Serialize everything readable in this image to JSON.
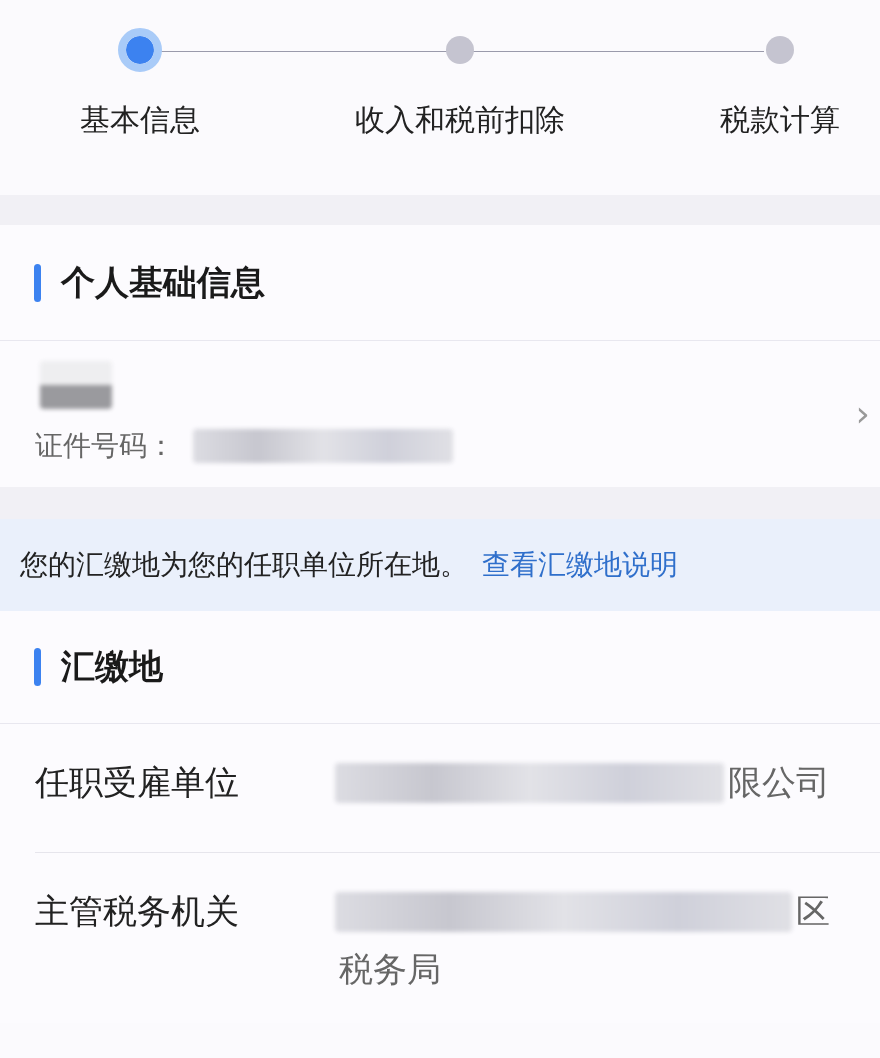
{
  "steps": [
    {
      "label": "基本信息",
      "selected": true
    },
    {
      "label": "收入和税前扣除",
      "selected": false
    },
    {
      "label": "税款计算",
      "selected": false
    }
  ],
  "personal": {
    "title": "个人基础信息",
    "name_redacted": true,
    "id_label": "证件号码：",
    "id_redacted": true,
    "chevron": "›"
  },
  "notice": {
    "text": "您的汇缴地为您的任职单位所在地。",
    "link": "查看汇缴地说明"
  },
  "filing_place": {
    "title": "汇缴地",
    "rows": [
      {
        "label": "任职受雇单位",
        "redacted": true,
        "lines": [
          "限公司"
        ]
      },
      {
        "label": "主管税务机关",
        "redacted": true,
        "lines": [
          "区",
          "税务局"
        ]
      }
    ]
  }
}
